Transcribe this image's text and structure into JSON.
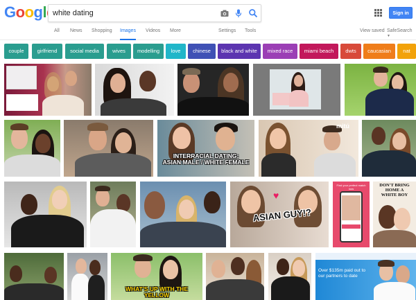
{
  "logo": [
    "G",
    "o",
    "o",
    "g",
    "l",
    "e"
  ],
  "search": {
    "query": "white dating"
  },
  "header": {
    "signin_label": "Sign in"
  },
  "nav": {
    "tabs": [
      "All",
      "News",
      "Shopping",
      "Images",
      "Videos",
      "More"
    ],
    "active_tab": "Images",
    "settings": "Settings",
    "tools": "Tools",
    "view_saved": "View saved",
    "safesearch": "SafeSearch"
  },
  "chips": [
    {
      "label": "couple",
      "color": "#2a9d8f"
    },
    {
      "label": "girlfriend",
      "color": "#2a9d8f"
    },
    {
      "label": "social media",
      "color": "#2a9d8f"
    },
    {
      "label": "wives",
      "color": "#2a9d8f"
    },
    {
      "label": "modelling",
      "color": "#2a9d8f"
    },
    {
      "label": "love",
      "color": "#21b6c9"
    },
    {
      "label": "chinese",
      "color": "#3f51b5"
    },
    {
      "label": "black and white",
      "color": "#5c35b0"
    },
    {
      "label": "mixed race",
      "color": "#9b3fb5"
    },
    {
      "label": "miami beach",
      "color": "#c2185b"
    },
    {
      "label": "dwts",
      "color": "#d84a3a"
    },
    {
      "label": "caucasian",
      "color": "#ef7d1a"
    },
    {
      "label": "nat",
      "color": "#f2a20a"
    }
  ],
  "image_captions": {
    "interracial_line1": "INTERRACIAL DATING:",
    "interracial_line2": "ASIAN MALE / WHITE FEMALE",
    "asian_guy": "ASIAN GUY!?",
    "mitu": "mitú",
    "book_line1": "DON'T BRING",
    "book_line2": "HOME A",
    "book_line3": "WHITE BOY",
    "whats_up": "WHAT'S UP WITH THE YELLOW",
    "ad_text": "Over $135m paid out to our partners to date",
    "phone_text": "Find your perfect match now"
  },
  "colors": {
    "accent": "#1a73e8",
    "signin": "#4285f4"
  }
}
